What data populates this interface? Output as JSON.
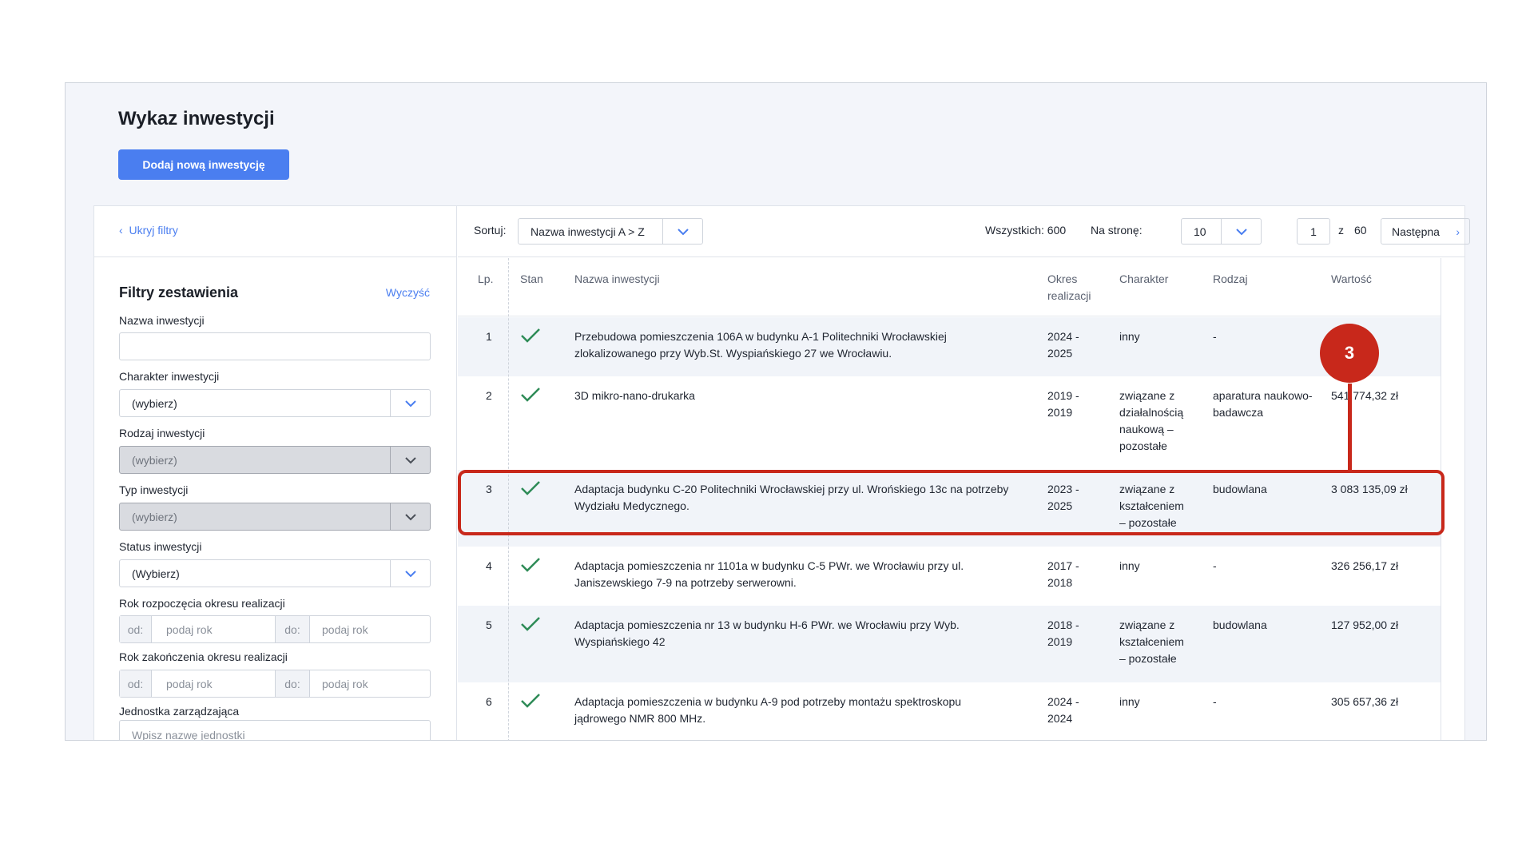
{
  "page": {
    "title": "Wykaz inwestycji",
    "add_button": "Dodaj nową inwestycję"
  },
  "filters": {
    "hide_link": "Ukryj filtry",
    "title": "Filtry zestawienia",
    "clear_link": "Wyczyść",
    "name_label": "Nazwa inwestycji",
    "name_value": "",
    "character_label": "Charakter inwestycji",
    "character_value": "(wybierz)",
    "kind_label": "Rodzaj inwestycji",
    "kind_value": "(wybierz)",
    "type_label": "Typ inwestycji",
    "type_value": "(wybierz)",
    "status_label": "Status inwestycji",
    "status_value": "(Wybierz)",
    "start_year_label": "Rok rozpoczęcia okresu realizacji",
    "end_year_label": "Rok zakończenia okresu realizacji",
    "from_label": "od:",
    "to_label": "do:",
    "year_placeholder": "podaj rok",
    "unit_label": "Jednostka zarządzająca",
    "unit_placeholder": "Wpisz nazwę jednostki"
  },
  "toolbar": {
    "sort_label": "Sortuj:",
    "sort_value": "Nazwa inwestycji A > Z",
    "total": "Wszystkich: 600",
    "per_page_label": "Na stronę:",
    "per_page_value": "10",
    "page_value": "1",
    "page_of": "z",
    "page_count": "60",
    "next_label": "Następna"
  },
  "table": {
    "headers": {
      "lp": "Lp.",
      "status": "Stan",
      "name": "Nazwa inwestycji",
      "period_1": "Okres",
      "period_2": "realizacji",
      "character": "Charakter",
      "kind": "Rodzaj",
      "value": "Wartość"
    },
    "rows": [
      {
        "lp": "1",
        "name": [
          "Przebudowa pomieszczenia 106A w budynku A-1 Politechniki Wrocławskiej",
          "zlokalizowanego przy Wyb.St. Wyspiańskiego 27 we Wrocławiu."
        ],
        "period": [
          "2024 -",
          "2025"
        ],
        "character": [
          "inny"
        ],
        "kind": [
          "-"
        ],
        "value": ""
      },
      {
        "lp": "2",
        "name": [
          "3D mikro-nano-drukarka"
        ],
        "period": [
          "2019 -",
          "2019"
        ],
        "character": [
          "związane z",
          "działalnością",
          "naukową –",
          "pozostałe"
        ],
        "kind": [
          "aparatura naukowo-",
          "badawcza"
        ],
        "value": "541 774,32 zł"
      },
      {
        "lp": "3",
        "name": [
          "Adaptacja budynku C-20 Politechniki Wrocławskiej przy ul. Wrońskiego 13c na potrzeby",
          "Wydziału Medycznego."
        ],
        "period": [
          "2023 -",
          "2025"
        ],
        "character": [
          "związane z",
          "kształceniem",
          "– pozostałe"
        ],
        "kind": [
          "budowlana"
        ],
        "value": "3 083 135,09 zł"
      },
      {
        "lp": "4",
        "name": [
          "Adaptacja pomieszczenia nr 1101a w budynku C-5 PWr. we Wrocławiu przy ul.",
          "Janiszewskiego 7-9 na potrzeby serwerowni."
        ],
        "period": [
          "2017 -",
          "2018"
        ],
        "character": [
          "inny"
        ],
        "kind": [
          "-"
        ],
        "value": "326 256,17 zł"
      },
      {
        "lp": "5",
        "name": [
          "Adaptacja pomieszczenia nr 13 w budynku H-6 PWr. we Wrocławiu przy Wyb.",
          "Wyspiańskiego 42"
        ],
        "period": [
          "2018 -",
          "2019"
        ],
        "character": [
          "związane z",
          "kształceniem",
          "– pozostałe"
        ],
        "kind": [
          "budowlana"
        ],
        "value": "127 952,00 zł"
      },
      {
        "lp": "6",
        "name": [
          "Adaptacja pomieszczenia w budynku A-9 pod potrzeby montażu spektroskopu",
          "jądrowego NMR 800 MHz."
        ],
        "period": [
          "2024 -",
          "2024"
        ],
        "character": [
          "inny"
        ],
        "kind": [
          "-"
        ],
        "value": "305 657,36 zł"
      }
    ]
  },
  "annotation": {
    "callout_number": "3",
    "color": "#c8281b"
  },
  "colors": {
    "accent": "#4a7ef0",
    "check": "#2e8b57"
  }
}
